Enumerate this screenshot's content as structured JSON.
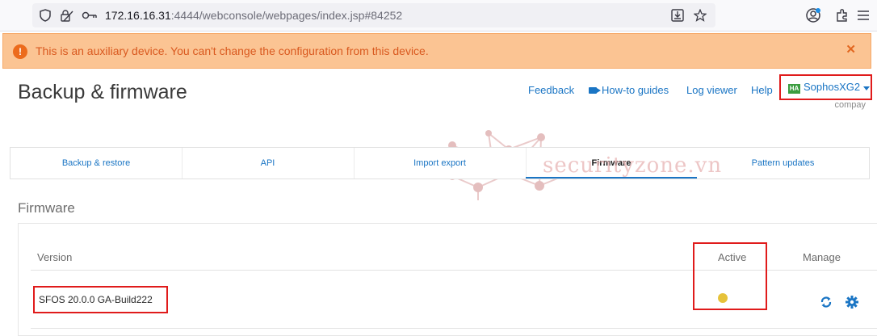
{
  "browser": {
    "url_host": "172.16.16.31",
    "url_path": ":4444/webconsole/webpages/index.jsp#84252"
  },
  "warning": {
    "text": "This is an auxiliary device. You can't change the configuration from this device.",
    "icon": "exclamation-icon",
    "close_icon": "close-icon"
  },
  "header": {
    "title": "Backup & firmware",
    "links": {
      "feedback": "Feedback",
      "howto": "How-to guides",
      "log_viewer": "Log viewer",
      "help": "Help"
    },
    "device": {
      "badge": "HA",
      "name": "SophosXG2",
      "company": "compay"
    }
  },
  "tabs": [
    {
      "label": "Backup & restore"
    },
    {
      "label": "API"
    },
    {
      "label": "Import export"
    },
    {
      "label": "Firmware",
      "active": true
    },
    {
      "label": "Pattern updates"
    }
  ],
  "firmware": {
    "section_title": "Firmware",
    "columns": {
      "version": "Version",
      "active": "Active",
      "manage": "Manage"
    },
    "rows": [
      {
        "version": "SFOS 20.0.0 GA-Build222",
        "active_status": "yellow"
      }
    ]
  },
  "watermark": "securityzone.vn",
  "colors": {
    "accent": "#1a75c4",
    "warning_bg": "#fbc493",
    "warning_text": "#d9591f",
    "highlight": "#e01b1b",
    "status_dot": "#e6c23a"
  }
}
